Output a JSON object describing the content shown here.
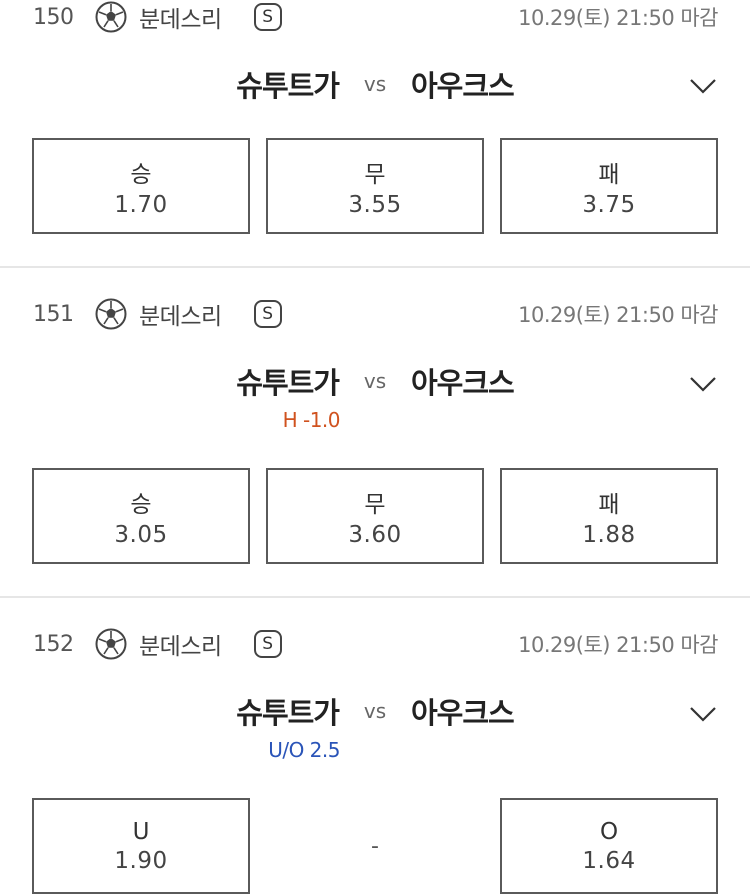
{
  "matches": [
    {
      "number": "150",
      "league": "분데스리",
      "badge": "S",
      "deadline": "10.29(토) 21:50 마감",
      "home": "슈투트가",
      "vs": "vs",
      "away": "아우크스",
      "subline": "",
      "odds": [
        {
          "label": "승",
          "value": "1.70"
        },
        {
          "label": "무",
          "value": "3.55"
        },
        {
          "label": "패",
          "value": "3.75"
        }
      ]
    },
    {
      "number": "151",
      "league": "분데스리",
      "badge": "S",
      "deadline": "10.29(토) 21:50 마감",
      "home": "슈투트가",
      "vs": "vs",
      "away": "아우크스",
      "subline": "H -1.0",
      "odds": [
        {
          "label": "승",
          "value": "3.05"
        },
        {
          "label": "무",
          "value": "3.60"
        },
        {
          "label": "패",
          "value": "1.88"
        }
      ]
    },
    {
      "number": "152",
      "league": "분데스리",
      "badge": "S",
      "deadline": "10.29(토) 21:50 마감",
      "home": "슈투트가",
      "vs": "vs",
      "away": "아우크스",
      "subline": "U/O 2.5",
      "odds": [
        {
          "label": "U",
          "value": "1.90"
        },
        {
          "label": "-",
          "value": ""
        },
        {
          "label": "O",
          "value": "1.64"
        }
      ]
    }
  ],
  "icons": {
    "sport": "soccer-ball-icon",
    "expand": "chevron-down-icon"
  },
  "colors": {
    "handicap": "#d0521f",
    "under_over": "#2a54b8",
    "divider": "#e6e6e6"
  }
}
